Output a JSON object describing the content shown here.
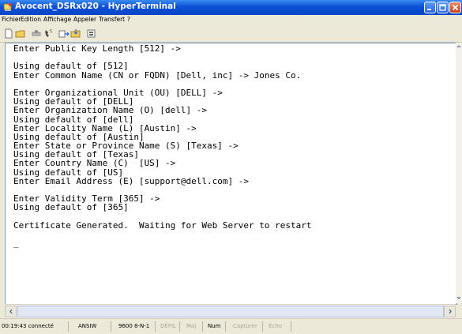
{
  "window": {
    "title": "Avocent_DSRx020 - HyperTerminal",
    "icon": "hyperterminal-app-icon"
  },
  "menu": [
    "Fichier",
    "Edition",
    "Affichage",
    "Appeler",
    "Transfert",
    "?"
  ],
  "toolbar": [
    "new-icon",
    "open-icon",
    "disconnect-icon",
    "call-icon",
    "send-icon",
    "receive-icon",
    "properties-icon"
  ],
  "terminal": {
    "lines": [
      "Enter Public Key Length [512] ->",
      "",
      "Using default of [512]",
      "Enter Common Name (CN or FQDN) [Dell, inc] -> Jones Co.",
      "",
      "Enter Organizational Unit (OU) [DELL] ->",
      "Using default of [DELL]",
      "Enter Organization Name (O) [dell] ->",
      "Using default of [dell]",
      "Enter Locality Name (L) [Austin] ->",
      "Using default of [Austin]",
      "Enter State or Province Name (S) [Texas] ->",
      "Using default of [Texas]",
      "Enter Country Name (C)  [US] ->",
      "Using default of [US]",
      "Enter Email Address (E) [support@dell.com] ->",
      "",
      "Enter Validity Term [365] ->",
      "Using default of [365]",
      "",
      "Certificate Generated.  Waiting for Web Server to restart",
      "",
      "_"
    ]
  },
  "status": {
    "connected": "00:19:43 connecté",
    "emulation": "ANSIW",
    "settings": "9600 8-N-1",
    "scroll": "DÉFIL",
    "caps": "Maj",
    "num": "Num",
    "capture": "Capturer",
    "echo": "Écho"
  },
  "colors": {
    "titlebar": "#0a4fd6",
    "close": "#c9441f",
    "chrome": "#ece9d8"
  }
}
